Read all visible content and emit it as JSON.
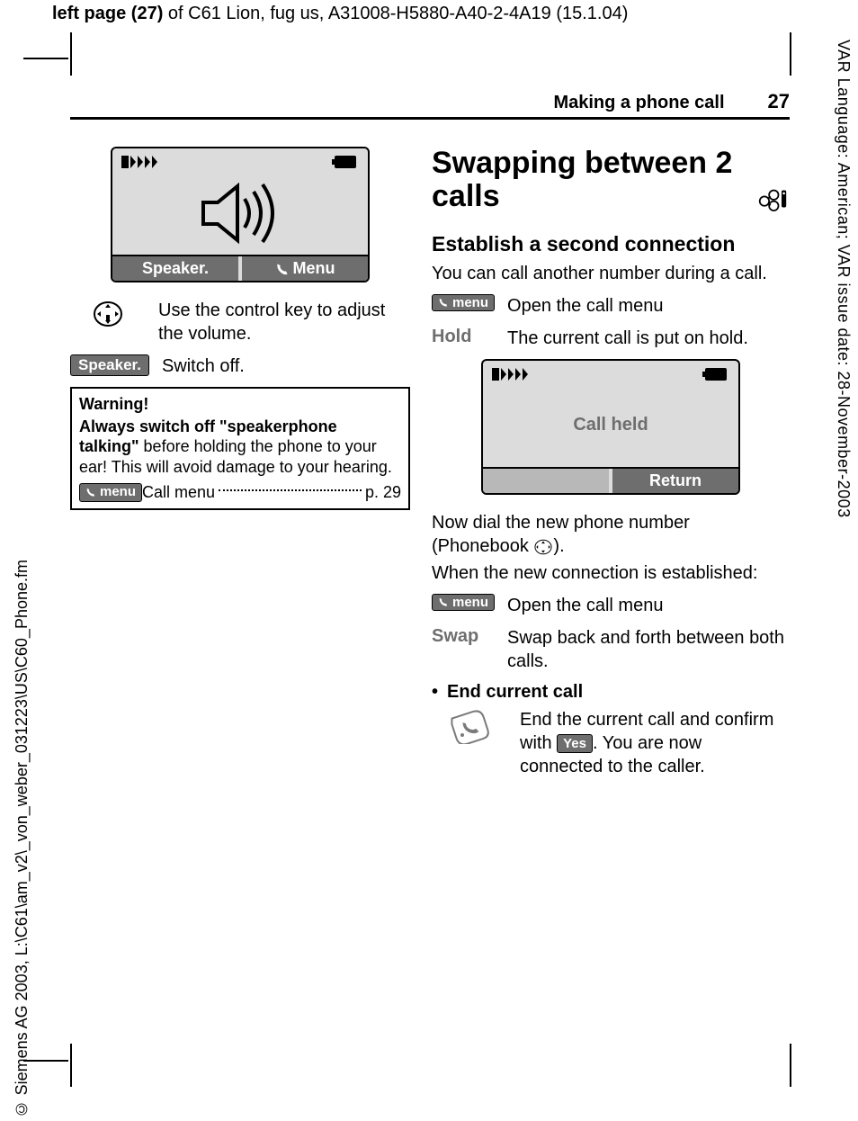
{
  "meta": {
    "top_header_bold": "left page (27)",
    "top_header_rest": " of C61 Lion, fug us, A31008-H5880-A40-2-4A19 (15.1.04)",
    "right_margin": "VAR Language: American; VAR issue date: 28-November-2003",
    "left_margin": "© Siemens AG 2003, L:\\C61\\am_v2\\_von_weber_031223\\US\\C60_Phone.fm"
  },
  "header": {
    "section": "Making a phone call",
    "page": "27"
  },
  "left": {
    "phone1": {
      "soft_left": "Speaker.",
      "soft_right": "Menu"
    },
    "row_volume": "Use the control key to adjust the volume.",
    "row_speaker_key": "Speaker.",
    "row_speaker_val": "Switch off.",
    "warn": {
      "title": "Warning!",
      "body_bold": "Always switch off \"speakerphone talking\"",
      "body_rest": " before holding the phone to your ear! This will avoid damage to your hearing.",
      "menu_pill": "menu",
      "call_menu": " Call menu",
      "page_ref": "p. 29"
    }
  },
  "right": {
    "title": "Swapping between 2 calls",
    "h2a": "Establish a second connection",
    "intro": "You can call another number during a call.",
    "menu_pill": "menu",
    "open_menu": "Open the call menu",
    "hold_key": "Hold",
    "hold_val": "The current call is put on hold.",
    "phone2": {
      "msg": "Call held",
      "soft_right": "Return"
    },
    "dial1": "Now dial the new phone number (Phonebook ",
    "dial2": ").",
    "established": "When the new connection is established:",
    "open_menu2": "Open the call menu",
    "swap_key": "Swap",
    "swap_val": "Swap back and forth between both calls.",
    "end_title": "End current call",
    "end_body1": "End the current call and confirm with ",
    "yes_pill": "Yes",
    "end_body2": ". You are now connected to the caller."
  }
}
